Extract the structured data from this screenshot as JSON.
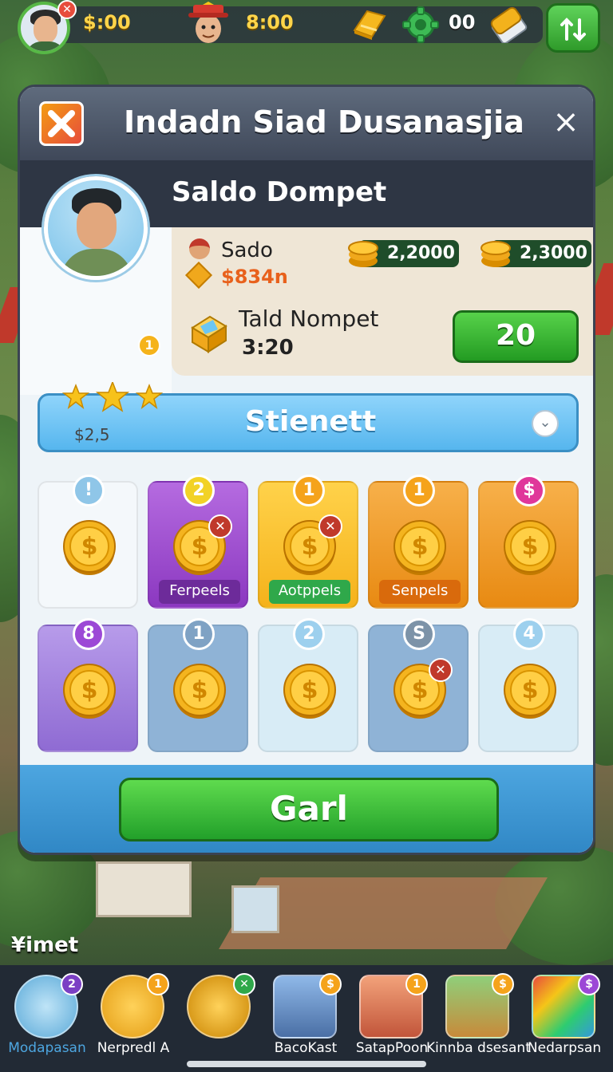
{
  "hud": {
    "coins": "$:00",
    "gems": "8:00",
    "gear_count": "00",
    "menu_icon": "sort-icon"
  },
  "dialog": {
    "title": "Indadn Siad Dusanasjia",
    "close": "×",
    "subtitle": "Saldo Dompet",
    "profile": {
      "level": "1",
      "stars": 3,
      "amount": "$2,5"
    },
    "wallet": {
      "label1": "Sado",
      "price": "$834n",
      "pill1": "2,2000",
      "pill2": "2,3000",
      "label2": "Tald Nompet",
      "time": "3:20",
      "button": "20"
    },
    "selector": {
      "label": "Stienett",
      "dropdown_icon": "chevron-down-icon"
    },
    "tiles": [
      {
        "badge": "!",
        "label": "",
        "x": false
      },
      {
        "badge": "2",
        "label": "Ferpeels",
        "x": true
      },
      {
        "badge": "1",
        "label": "Aotppels",
        "x": true
      },
      {
        "badge": "1",
        "label": "Senpels",
        "x": false
      },
      {
        "badge": "$",
        "label": "",
        "x": false
      },
      {
        "badge": "8",
        "label": "",
        "x": false
      },
      {
        "badge": "1",
        "label": "",
        "x": false
      },
      {
        "badge": "2",
        "label": "",
        "x": false
      },
      {
        "badge": "S",
        "label": "",
        "x": true
      },
      {
        "badge": "4",
        "label": "",
        "x": false
      }
    ],
    "cta": "Garl"
  },
  "bottom": {
    "label": "¥imet",
    "nav": [
      {
        "label": "Modapasan",
        "badge": "2"
      },
      {
        "label": "Nerpredl A",
        "badge": "1"
      },
      {
        "label": "",
        "badge": "✕"
      },
      {
        "label": "BacoKast",
        "badge": "$"
      },
      {
        "label": "SatapPoon",
        "badge": "1"
      },
      {
        "label": "Kinnba dsesant",
        "badge": "$"
      },
      {
        "label": "Nedarpsan",
        "badge": "$"
      }
    ]
  },
  "colors": {
    "primary_green": "#2f9b2a",
    "accent_blue": "#56b6ee",
    "accent_orange": "#f39c12",
    "accent_purple": "#a04ad0"
  }
}
